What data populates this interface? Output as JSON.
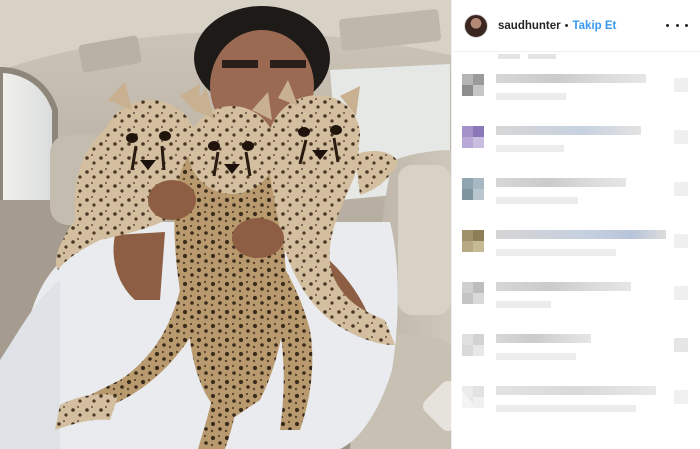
{
  "post": {
    "username": "saudhunter",
    "separator": "•",
    "follow_label": "Takip Et",
    "photo_description_icon": "cheetah-cubs-photo"
  },
  "colors": {
    "follow_blue": "#3897f0",
    "text": "#262626",
    "border": "#efefef"
  },
  "icons": {
    "more": "more-options-icon",
    "like": "heart-icon"
  }
}
